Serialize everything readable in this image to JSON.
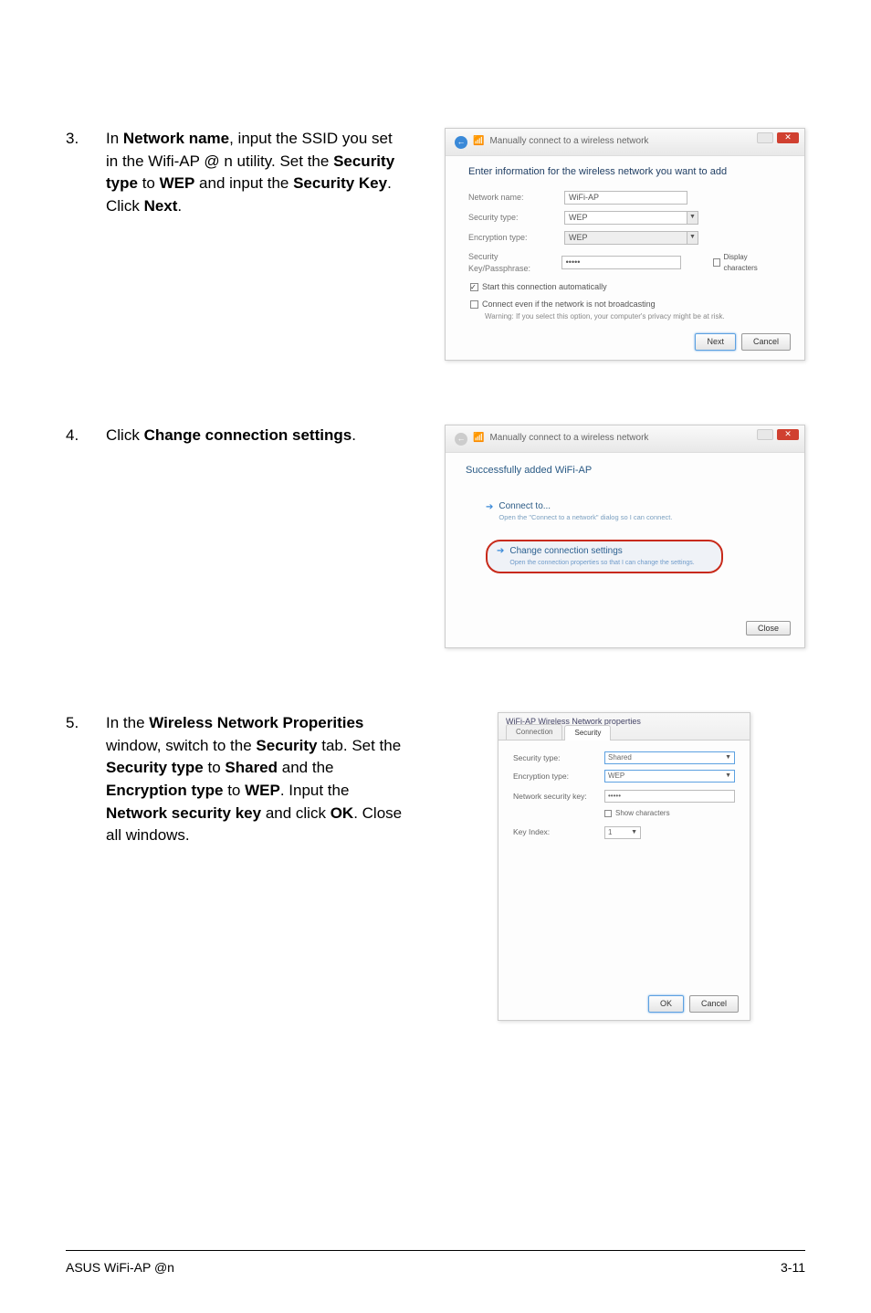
{
  "steps": {
    "s3": {
      "num": "3.",
      "text_parts": [
        "In ",
        "Network name",
        ", input the SSID you set in the Wifi-AP @ n utility. Set the ",
        "Security type",
        " to ",
        "WEP",
        " and input the ",
        "Security Key",
        ". Click ",
        "Next",
        "."
      ]
    },
    "s4": {
      "num": "4.",
      "text_parts": [
        "Click ",
        "Change connection settings",
        "."
      ]
    },
    "s5": {
      "num": "5.",
      "text_parts": [
        "In the ",
        "Wireless Network Properities",
        " window, switch to the ",
        "Security",
        " tab. Set the ",
        "Security type",
        " to ",
        "Shared",
        " and the ",
        "Encryption type",
        " to ",
        "WEP",
        ". Input the ",
        "Network security key",
        " and click ",
        "OK",
        ". Close all windows."
      ]
    }
  },
  "dialog3": {
    "breadcrumb": "Manually connect to a wireless network",
    "title": "Enter information for the wireless network you want to add",
    "labels": {
      "network_name": "Network name:",
      "security_type": "Security type:",
      "encryption_type": "Encryption type:",
      "security_key": "Security Key/Passphrase:"
    },
    "values": {
      "network_name": "WiFi-AP",
      "security_type": "WEP",
      "encryption_type": "WEP",
      "security_key": "•••••"
    },
    "display_chars": "Display characters",
    "chk1": "Start this connection automatically",
    "chk2": "Connect even if the network is not broadcasting",
    "warning": "Warning: If you select this option, your computer's privacy might be at risk.",
    "btn_next": "Next",
    "btn_cancel": "Cancel"
  },
  "dialog4": {
    "breadcrumb": "Manually connect to a wireless network",
    "title": "Successfully added WiFi-AP",
    "connect_title": "Connect to...",
    "connect_sub": "Open the \"Connect to a network\" dialog so I can connect.",
    "change_title": "Change connection settings",
    "change_sub": "Open the connection properties so that I can change the settings.",
    "btn_close": "Close"
  },
  "dialog5": {
    "window_title": "WiFi-AP Wireless Network properties",
    "tab_connection": "Connection",
    "tab_security": "Security",
    "labels": {
      "security_type": "Security type:",
      "encryption_type": "Encryption type:",
      "network_key": "Network security key:",
      "key_index": "Key Index:"
    },
    "values": {
      "security_type": "Shared",
      "encryption_type": "WEP",
      "network_key": "•••••",
      "key_index": "1"
    },
    "show_chars": "Show characters",
    "btn_ok": "OK",
    "btn_cancel": "Cancel"
  },
  "footer": {
    "left": "ASUS WiFi-AP @n",
    "right": "3-11"
  }
}
